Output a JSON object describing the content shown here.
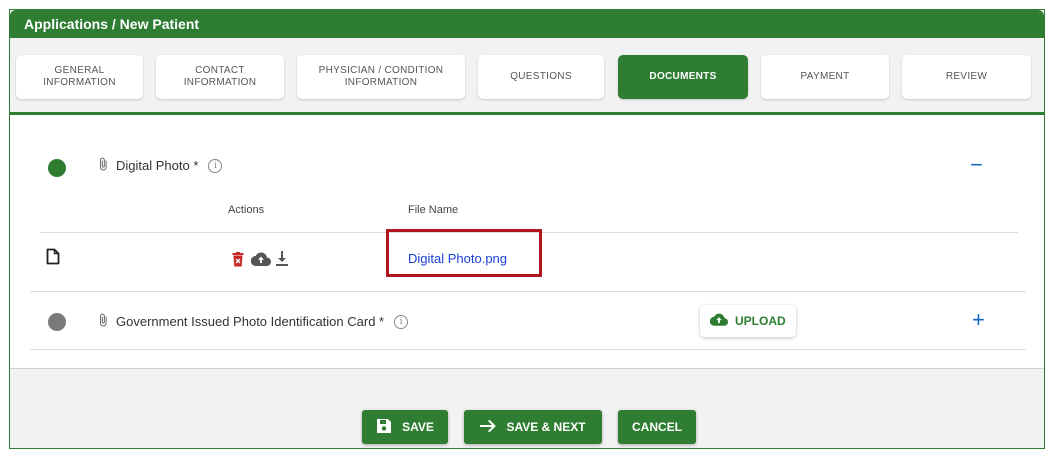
{
  "header": {
    "title": "Applications / New Patient"
  },
  "tabs": [
    {
      "line1": "GENERAL",
      "line2": "INFORMATION"
    },
    {
      "line1": "CONTACT",
      "line2": "INFORMATION"
    },
    {
      "line1": "PHYSICIAN / CONDITION",
      "line2": "INFORMATION"
    },
    {
      "line1": "QUESTIONS",
      "line2": ""
    },
    {
      "line1": "DOCUMENTS",
      "line2": ""
    },
    {
      "line1": "PAYMENT",
      "line2": ""
    },
    {
      "line1": "REVIEW",
      "line2": ""
    }
  ],
  "active_tab": "DOCUMENTS",
  "documents": {
    "digital_photo": {
      "title": "Digital Photo *",
      "status": "complete",
      "toggle": "−",
      "actions_header": "Actions",
      "filename_header": "File Name",
      "file_name": "Digital Photo.png"
    },
    "gov_id": {
      "title": "Government Issued Photo Identification Card *",
      "status": "pending",
      "upload_label": "UPLOAD",
      "toggle": "+"
    }
  },
  "footer": {
    "save_label": "SAVE",
    "save_next_label": "SAVE & NEXT",
    "cancel_label": "CANCEL"
  },
  "colors": {
    "brand_green": "#2e7d32",
    "link_blue": "#1a3fd6",
    "highlight_red": "#b0161e",
    "delete_red": "#c62828"
  }
}
